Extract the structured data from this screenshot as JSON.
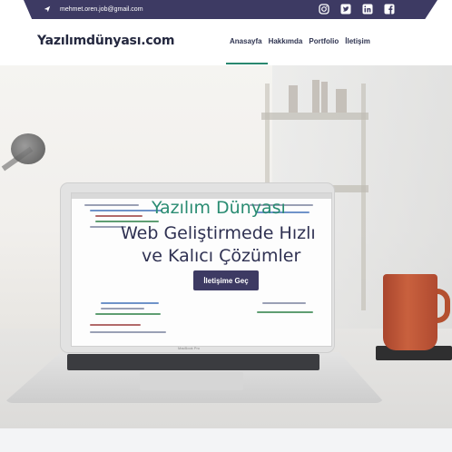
{
  "topbar": {
    "email": "mehmet.oren.job@gmail.com",
    "social": [
      "instagram-icon",
      "twitter-icon",
      "linkedin-icon",
      "facebook-icon"
    ],
    "color": "#3d3a63"
  },
  "header": {
    "brand": "Yazılımdünyası.com",
    "nav": [
      "Anasayfa",
      "Hakkımda",
      "Portfolio",
      "İletişim"
    ],
    "active_index": 0,
    "accent": "#29886f"
  },
  "hero": {
    "title": "Yazılım Dünyası",
    "subtitle_line1": "Web Geliştirmede Hızlı",
    "subtitle_line2": "ve Kalıcı Çözümler",
    "cta": "İletişime Geç",
    "laptop_label": "MacBook Pro",
    "title_color": "#2a8c72",
    "subtitle_color": "#2f3152"
  }
}
